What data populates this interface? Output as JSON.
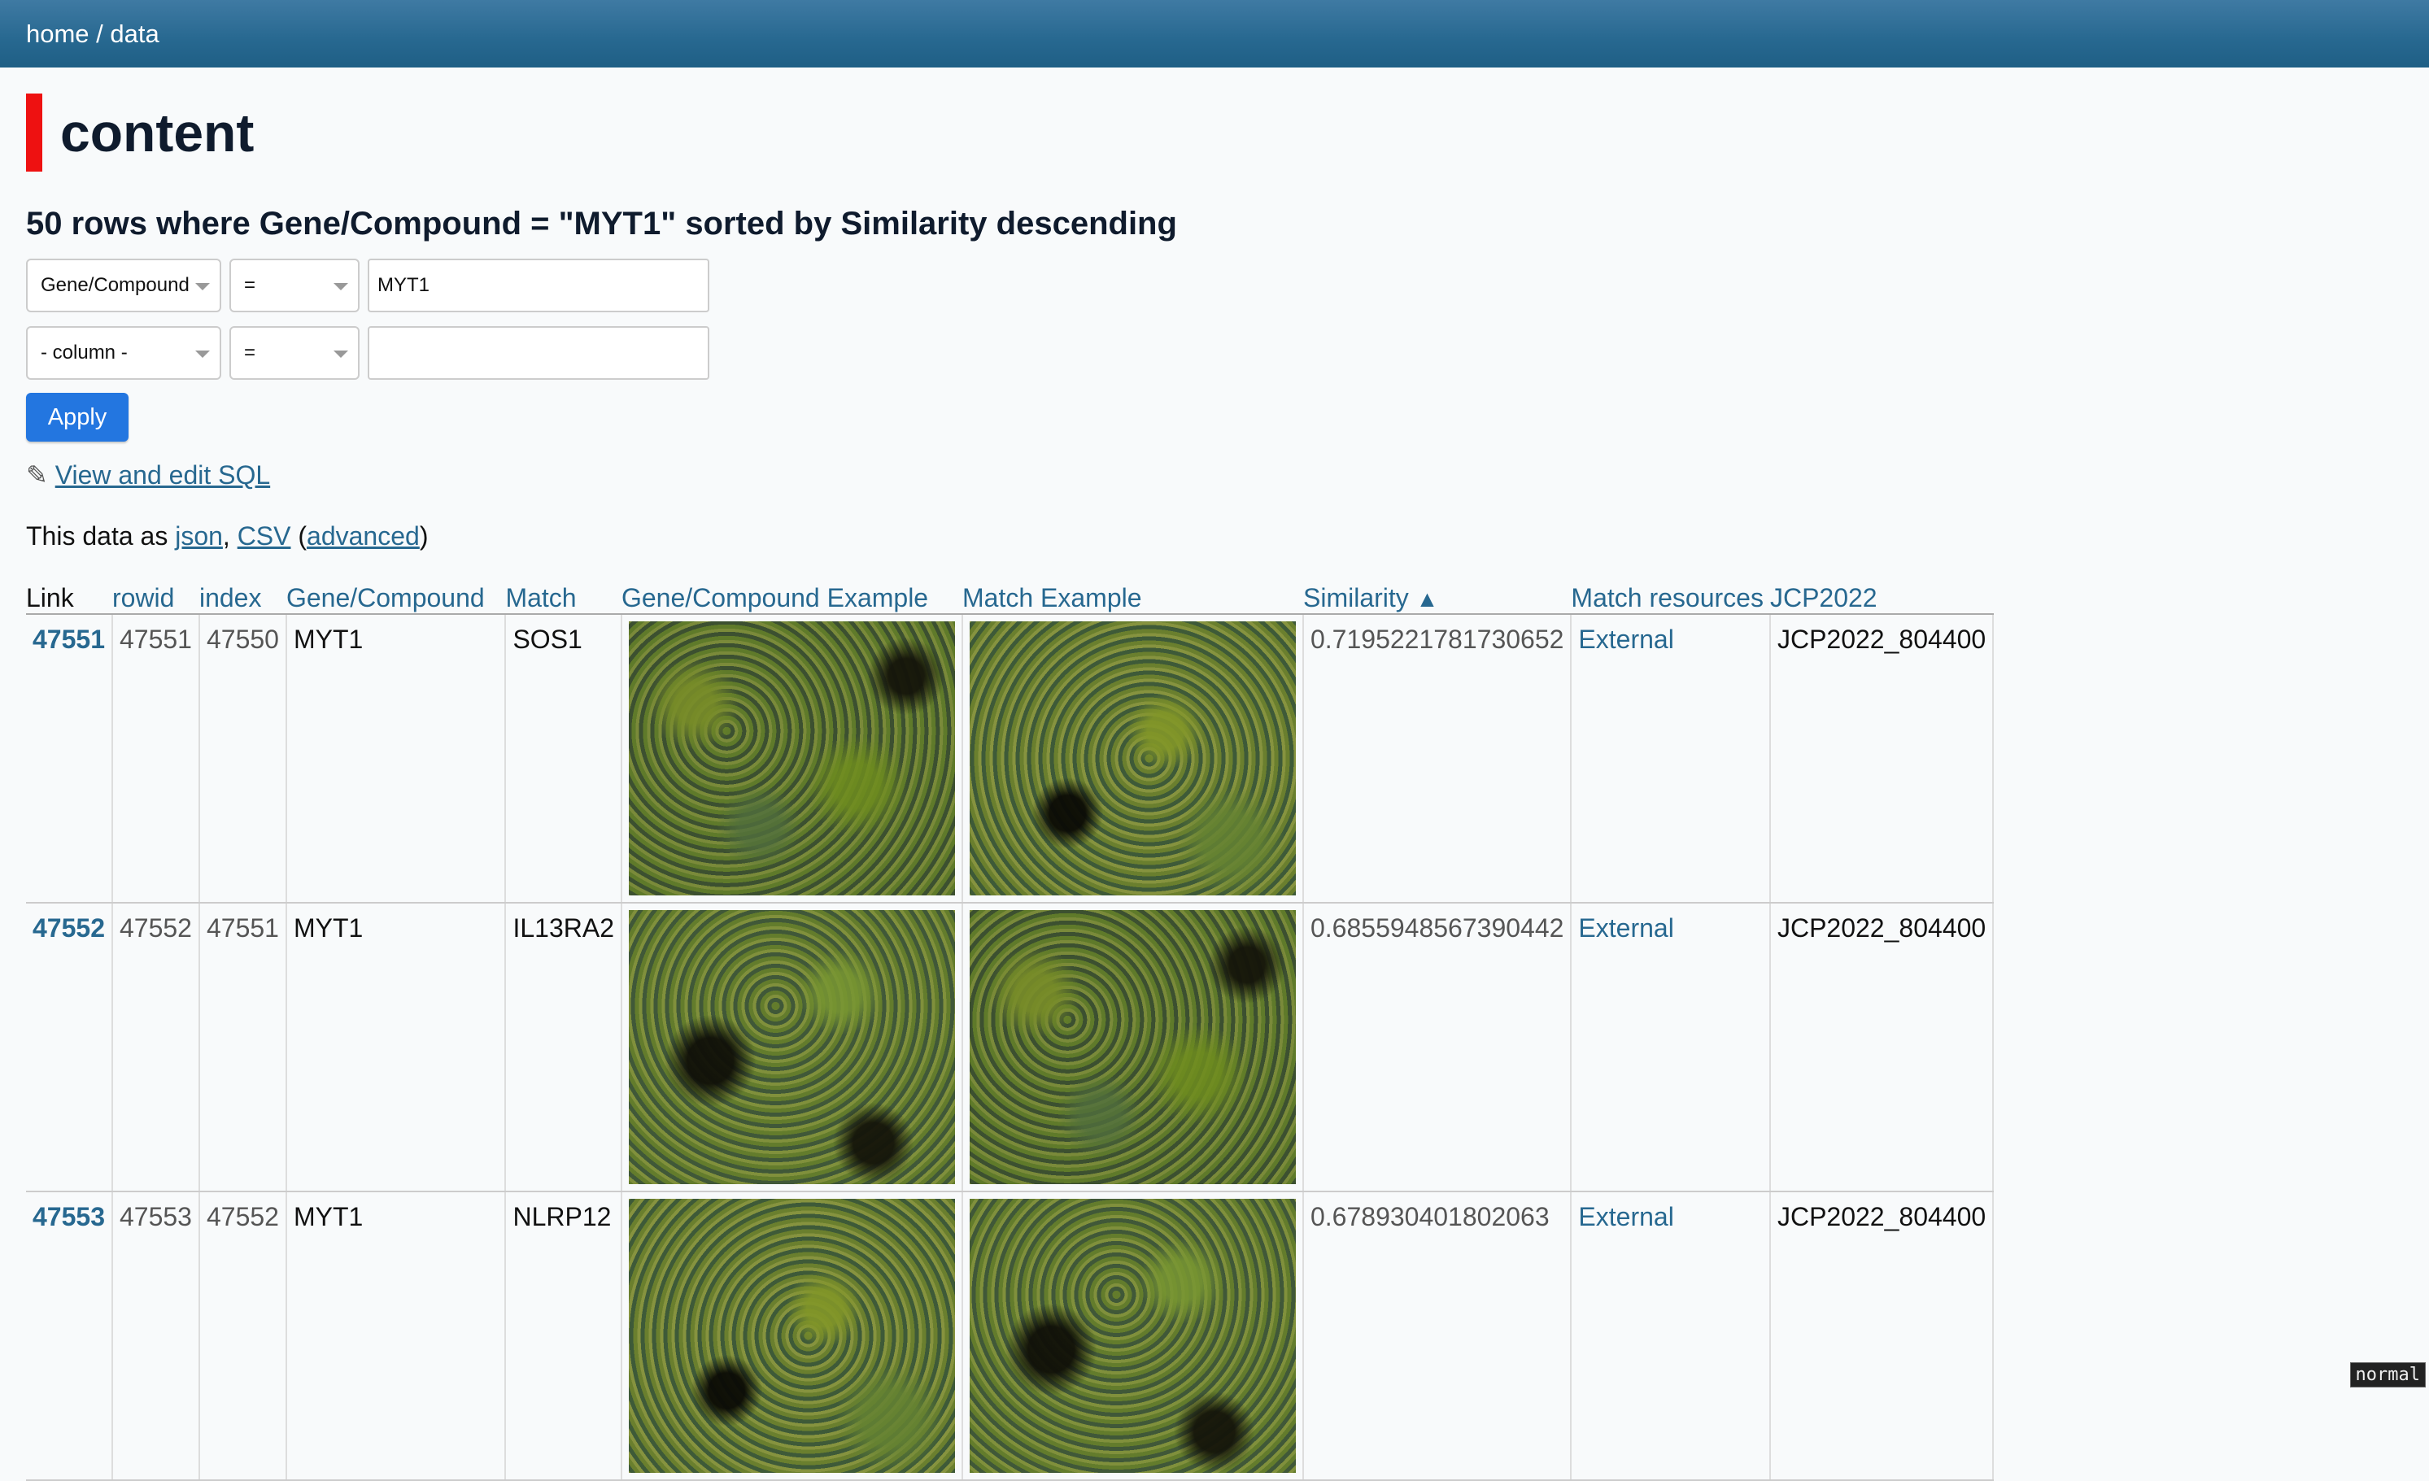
{
  "breadcrumb": {
    "home": "home",
    "sep": " / ",
    "current": "data"
  },
  "title": "content",
  "summary": "50 rows where Gene/Compound = \"MYT1\" sorted by Similarity descending",
  "filters": [
    {
      "column": "Gene/Compound",
      "op": "=",
      "value": "MYT1",
      "placeholder": ""
    },
    {
      "column": "- column -",
      "op": "=",
      "value": "",
      "placeholder": ""
    }
  ],
  "apply_label": "Apply",
  "sql_link": "View and edit SQL",
  "export": {
    "prefix": "This data as ",
    "json": "json",
    "comma": ", ",
    "csv": "CSV",
    "open": " (",
    "advanced": "advanced",
    "close": ")"
  },
  "table": {
    "headers": [
      "Link",
      "rowid",
      "index",
      "Gene/Compound",
      "Match",
      "Gene/Compound Example",
      "Match Example",
      "Similarity",
      "Match resources",
      "JCP2022"
    ],
    "sort_arrow": "▲",
    "rows": [
      {
        "link": "47551",
        "rowid": "47551",
        "index": "47550",
        "gene": "MYT1",
        "match": "SOS1",
        "similarity": "0.7195221781730652",
        "resources": "External",
        "jcp": "JCP2022_804400"
      },
      {
        "link": "47552",
        "rowid": "47552",
        "index": "47551",
        "gene": "MYT1",
        "match": "IL13RA2",
        "similarity": "0.6855948567390442",
        "resources": "External",
        "jcp": "JCP2022_804400"
      },
      {
        "link": "47553",
        "rowid": "47553",
        "index": "47552",
        "gene": "MYT1",
        "match": "NLRP12",
        "similarity": "0.678930401802063",
        "resources": "External",
        "jcp": "JCP2022_804400"
      }
    ]
  },
  "mode_indicator": "normal"
}
